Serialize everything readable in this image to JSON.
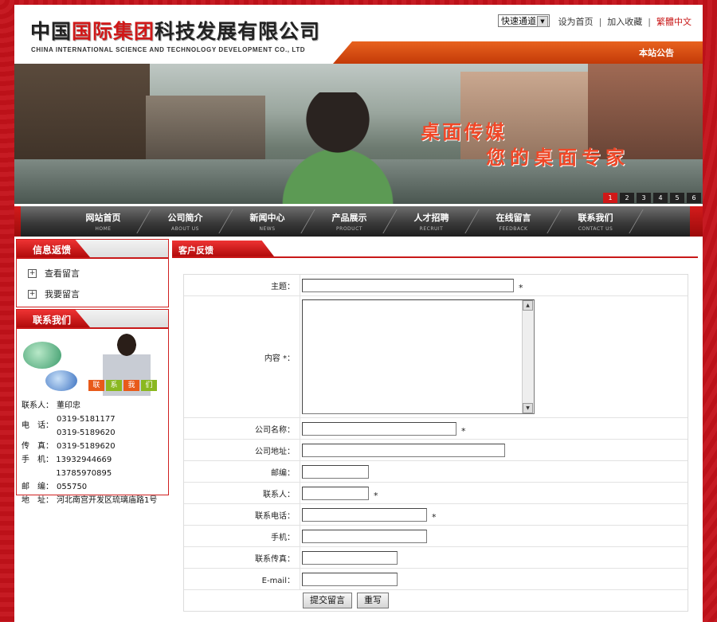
{
  "header": {
    "company_cn_black1": "中国",
    "company_cn_red": "国际集团",
    "company_cn_black2": "科技发展有限公司",
    "company_en": "CHINA INTERNATIONAL SCIENCE AND TECHNOLOGY DEVELOPMENT CO., LTD",
    "quick_select": "快速通道",
    "links": [
      "设为首页",
      "加入收藏",
      "繁體中文"
    ],
    "notice_label": "本站公告"
  },
  "banner": {
    "slogan1": "桌面传媒",
    "slogan2": "您的桌面专家",
    "pages": [
      "1",
      "2",
      "3",
      "4",
      "5",
      "6"
    ],
    "active_page": "1"
  },
  "nav": [
    {
      "cn": "网站首页",
      "en": "HOME"
    },
    {
      "cn": "公司简介",
      "en": "ABOUT US"
    },
    {
      "cn": "新闻中心",
      "en": "NEWS"
    },
    {
      "cn": "产品展示",
      "en": "PRODUCT"
    },
    {
      "cn": "人才招聘",
      "en": "RECRUIT"
    },
    {
      "cn": "在线留言",
      "en": "FEEDBACK"
    },
    {
      "cn": "联系我们",
      "en": "CONTACT US"
    }
  ],
  "sidebar": {
    "feedback_title": "信息返馈",
    "feedback_items": [
      "查看留言",
      "我要留言"
    ],
    "contact_title": "联系我们",
    "contact_tag": [
      "联",
      "系",
      "我",
      "们"
    ],
    "contact": {
      "person_label": "联系人：",
      "person": "董印忠",
      "tel_label": "电　话：",
      "tel1": "0319-5181177",
      "tel2": "0319-5189620",
      "fax_label": "传　真：",
      "fax": "0319-5189620",
      "mobile_label": "手　机：",
      "mobile": "13932944669 13785970895",
      "zip_label": "邮　编：",
      "zip": "055750",
      "addr_label": "地　址：",
      "addr": "河北南宫开发区琉璃庙路1号"
    }
  },
  "main": {
    "title": "客户反馈",
    "fields": {
      "subject": "主题：",
      "content": "内容 *：",
      "company": "公司名称：",
      "address": "公司地址：",
      "zip": "邮编：",
      "contact": "联系人：",
      "phone": "联系电话：",
      "mobile": "手机：",
      "fax": "联系传真：",
      "email": "E-mail："
    },
    "required_mark": "*",
    "submit": "提交留言",
    "reset": "重写"
  }
}
